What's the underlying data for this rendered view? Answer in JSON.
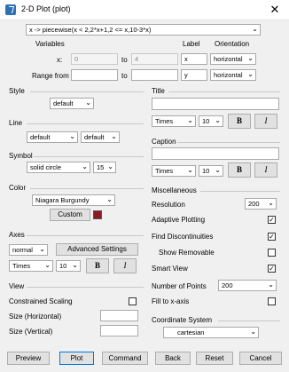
{
  "window": {
    "title": "2-D Plot (plot)"
  },
  "expression": {
    "value": "x -> piecewise(x < 2,2*x+1,2 <= x,10-3*x)"
  },
  "variables": {
    "heading": "Variables",
    "label_heading": "Label",
    "orientation_heading": "Orientation",
    "x_label": "x:",
    "x_from": "0",
    "to1": "to",
    "x_to": "4",
    "x_axis_label": "x",
    "x_orientation": "horizontal",
    "range_label": "Range from",
    "range_from": "",
    "to2": "to",
    "range_to": "",
    "y_axis_label": "y",
    "y_orientation": "horizontal"
  },
  "style": {
    "heading": "Style",
    "value": "default"
  },
  "line": {
    "heading": "Line",
    "style_value": "default",
    "width_value": "default"
  },
  "symbol": {
    "heading": "Symbol",
    "value": "solid circle",
    "size": "15"
  },
  "color": {
    "heading": "Color",
    "value": "Niagara Burgundy",
    "custom_label": "Custom",
    "swatch": "#8b1a24"
  },
  "axes": {
    "heading": "Axes",
    "value": "normal",
    "advanced_label": "Advanced Settings",
    "font": "Times",
    "size": "10",
    "bold": "B",
    "italic": "I"
  },
  "view": {
    "heading": "View",
    "constrained_label": "Constrained Scaling",
    "size_h_label": "Size (Horizontal)",
    "size_v_label": "Size (Vertical)",
    "size_h": "",
    "size_v": ""
  },
  "title_section": {
    "heading": "Title",
    "value": "",
    "font": "Times",
    "size": "10",
    "bold": "B",
    "italic": "I"
  },
  "caption_section": {
    "heading": "Caption",
    "value": "",
    "font": "Times",
    "size": "10",
    "bold": "B",
    "italic": "I"
  },
  "misc": {
    "heading": "Miscellaneous",
    "resolution_label": "Resolution",
    "resolution_value": "200",
    "adaptive_label": "Adaptive Plotting",
    "discont_label": "Find Discontinuities",
    "removable_label": "Show Removable",
    "smartview_label": "Smart View",
    "points_label": "Number of Points",
    "points_value": "200",
    "fill_label": "Fill to x-axis",
    "check_mark": "✓"
  },
  "coords": {
    "heading": "Coordinate System",
    "value": "cartesian"
  },
  "footer": {
    "preview": "Preview",
    "plot": "Plot",
    "command": "Command",
    "back": "Back",
    "reset": "Reset",
    "cancel": "Cancel"
  }
}
